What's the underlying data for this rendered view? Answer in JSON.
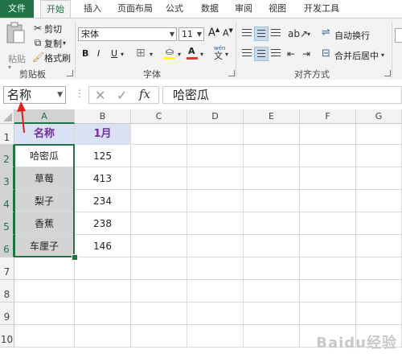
{
  "ribbon_tabs": [
    "文件",
    "开始",
    "插入",
    "页面布局",
    "公式",
    "数据",
    "审阅",
    "视图",
    "开发工具"
  ],
  "active_tab_index": 1,
  "clipboard": {
    "paste_label": "粘贴",
    "cut_label": "剪切",
    "copy_label": "复制",
    "format_painter_label": "格式刷",
    "group_label": "剪贴板"
  },
  "font": {
    "name": "宋体",
    "size": "11",
    "grow_label": "A",
    "shrink_label": "A",
    "bold": "B",
    "italic": "I",
    "underline": "U",
    "color_label": "A",
    "wen_label": "wén",
    "group_label": "字体",
    "color_hex": "#e03c31",
    "highlight_hex": "#ffff00"
  },
  "alignment": {
    "wrap_label": "自动换行",
    "merge_label": "合并后居中",
    "group_label": "对齐方式"
  },
  "formula_bar": {
    "name_box": "名称",
    "cancel_icon": "✕",
    "enter_icon": "✓",
    "fx_label": "fx",
    "content": "哈密瓜"
  },
  "grid": {
    "columns": [
      "A",
      "B",
      "C",
      "D",
      "E",
      "F",
      "G"
    ],
    "rows": [
      "1",
      "2",
      "3",
      "4",
      "5",
      "6",
      "7",
      "8",
      "9",
      "10"
    ],
    "cells": [
      [
        "名称",
        "1月"
      ],
      [
        "哈密瓜",
        "125"
      ],
      [
        "草莓",
        "413"
      ],
      [
        "梨子",
        "234"
      ],
      [
        "香蕉",
        "238"
      ],
      [
        "车厘子",
        "146"
      ]
    ]
  },
  "accent_color": "#217346",
  "header_fill": "#d9e1f2",
  "header_text_color": "#7030a0",
  "watermark": "Baidu经验"
}
